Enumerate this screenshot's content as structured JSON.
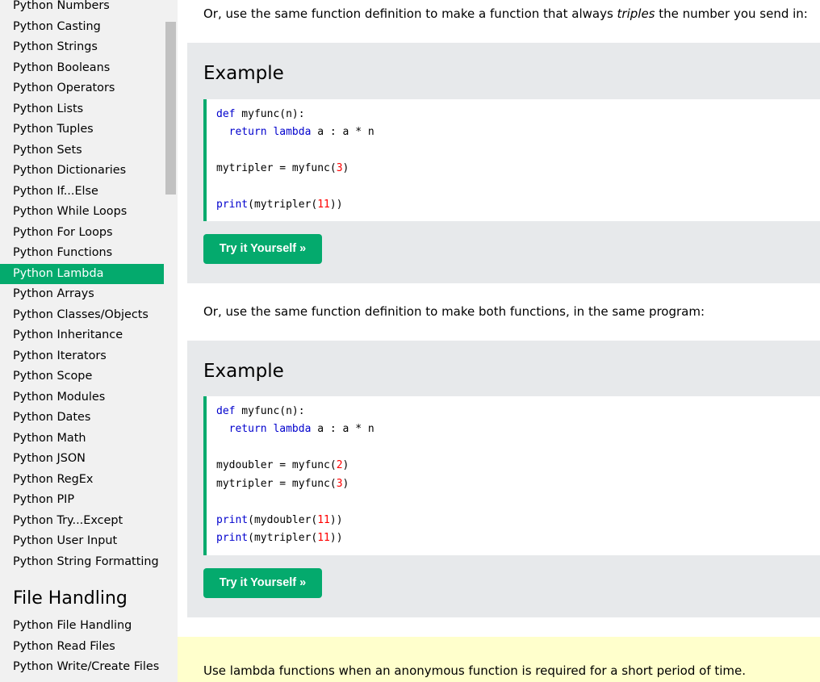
{
  "sidebar": {
    "items": [
      "Python Numbers",
      "Python Casting",
      "Python Strings",
      "Python Booleans",
      "Python Operators",
      "Python Lists",
      "Python Tuples",
      "Python Sets",
      "Python Dictionaries",
      "Python If...Else",
      "Python While Loops",
      "Python For Loops",
      "Python Functions",
      "Python Lambda",
      "Python Arrays",
      "Python Classes/Objects",
      "Python Inheritance",
      "Python Iterators",
      "Python Scope",
      "Python Modules",
      "Python Dates",
      "Python Math",
      "Python JSON",
      "Python RegEx",
      "Python PIP",
      "Python Try...Except",
      "Python User Input",
      "Python String Formatting"
    ],
    "active_item": "Python Lambda",
    "section_heading": "File Handling",
    "section_items": [
      "Python File Handling",
      "Python Read Files",
      "Python Write/Create Files"
    ]
  },
  "content": {
    "para1_prefix": "Or, use the same function definition to make a function that always ",
    "para1_em": "triples",
    "para1_suffix": " the number you send in:",
    "example1": {
      "heading": "Example",
      "code": {
        "l1_kw": "def",
        "l1_rest": " myfunc(n):",
        "l2_kw": "return",
        "l2_kw2": "lambda",
        "l2_rest": " a : a * n",
        "l3_a": "mytripler = myfunc(",
        "l3_num": "3",
        "l3_b": ")",
        "l4_kw": "print",
        "l4_a": "(mytripler(",
        "l4_num": "11",
        "l4_b": "))"
      },
      "button": "Try it Yourself »"
    },
    "para2": "Or, use the same function definition to make both functions, in the same program:",
    "example2": {
      "heading": "Example",
      "code": {
        "l1_kw": "def",
        "l1_rest": " myfunc(n):",
        "l2_kw": "return",
        "l2_kw2": "lambda",
        "l2_rest": " a : a * n",
        "l3_a": "mydoubler = myfunc(",
        "l3_num": "2",
        "l3_b": ")",
        "l4_a": "mytripler = myfunc(",
        "l4_num": "3",
        "l4_b": ")",
        "l5_kw": "print",
        "l5_a": "(mydoubler(",
        "l5_num": "11",
        "l5_b": "))",
        "l6_kw": "print",
        "l6_a": "(mytripler(",
        "l6_num": "11",
        "l6_b": "))"
      },
      "button": "Try it Yourself »"
    },
    "note": "Use lambda functions when an anonymous function is required for a short period of time."
  },
  "colors": {
    "accent": "#04aa6d",
    "example_bg": "#e7e9eb",
    "note_bg": "#ffffcc",
    "keyword": "#0000cd",
    "number": "#ff0000"
  }
}
